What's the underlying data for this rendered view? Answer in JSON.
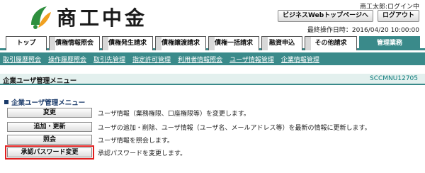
{
  "header": {
    "logo_text": "商工中金",
    "user_status": "商工太郎:ログイン中",
    "buttons": [
      "ビジネスWebトップページへ",
      "ログアウト"
    ],
    "last_login": "最終操作日時：2016/04/20 10:00:00"
  },
  "tabs": [
    {
      "label": "トップ",
      "active": false
    },
    {
      "label": "債権情報照会",
      "active": false
    },
    {
      "label": "債権発生請求",
      "active": false
    },
    {
      "label": "債権譲渡請求",
      "active": false
    },
    {
      "label": "債権一括請求",
      "active": false
    },
    {
      "label": "融資申込",
      "active": false
    },
    {
      "label": "その他請求",
      "active": false
    },
    {
      "label": "管理業務",
      "active": true
    }
  ],
  "subnav": [
    "取引履歴照会",
    "操作履歴照会",
    "取引先管理",
    "指定許可管理",
    "利用者情報照会",
    "ユーザ情報管理",
    "企業情報管理"
  ],
  "page": {
    "title": "企業ユーザ管理メニュー",
    "screen_id": "SCCMNU12705",
    "section_title": "企業ユーザ管理メニュー"
  },
  "menu": [
    {
      "button": "変更",
      "desc": "ユーザ情報（業務権限、口座権限等）を変更します。"
    },
    {
      "button": "追加・更新",
      "desc": "ユーザの追加・削除、ユーザ情報（ユーザ名、メールアドレス等）を最新の情報に更新します。"
    },
    {
      "button": "照会",
      "desc": "ユーザ情報を照会します。"
    },
    {
      "button": "承認パスワード変更",
      "desc": "承認パスワードを変更します。"
    }
  ],
  "colors": {
    "accent": "#3a8a8a",
    "focus": "#e02020"
  }
}
